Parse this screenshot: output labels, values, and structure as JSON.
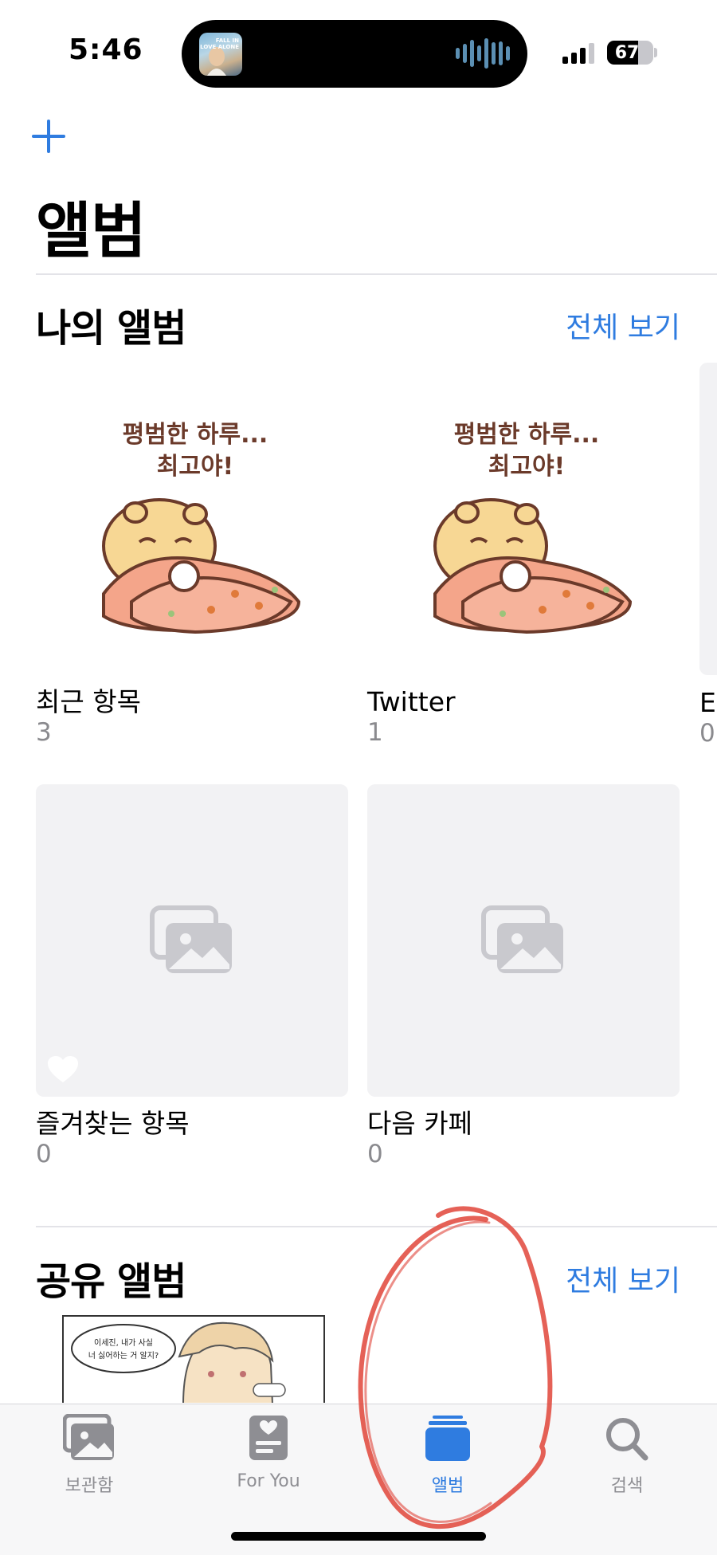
{
  "status_bar": {
    "time": "5:46",
    "battery": "67",
    "battery_level": 0.67,
    "now_playing_art_text": "FALL IN LOVE ALONE"
  },
  "header": {
    "title": "앨범"
  },
  "my_albums": {
    "title": "나의 앨범",
    "see_all": "전체 보기",
    "albums": [
      {
        "name": "최근 항목",
        "count": "3"
      },
      {
        "name": "Twitter",
        "count": "1"
      },
      {
        "name": "즐겨찾는 항목",
        "count": "0"
      },
      {
        "name": "다음 카페",
        "count": "0"
      }
    ],
    "partial_album": {
      "name": "E",
      "count": "0"
    },
    "sticker_text": [
      "평범한 하루...",
      "최고야!"
    ]
  },
  "shared_albums": {
    "title": "공유 앨범",
    "see_all": "전체 보기",
    "comic_bubble": [
      "이세진, 내가 사실",
      "너 싫어하는 거 알지?"
    ]
  },
  "tab_bar": {
    "tabs": [
      {
        "label": "보관함",
        "icon": "photo-library-icon"
      },
      {
        "label": "For You",
        "icon": "for-you-icon"
      },
      {
        "label": "앨범",
        "icon": "albums-stack-icon",
        "active": true
      },
      {
        "label": "검색",
        "icon": "search-icon"
      }
    ]
  },
  "colors": {
    "accent": "#2f7ce0",
    "secondary_text": "#8a8a8e",
    "placeholder_bg": "#f2f2f4",
    "annotation_red": "#e0453a"
  }
}
